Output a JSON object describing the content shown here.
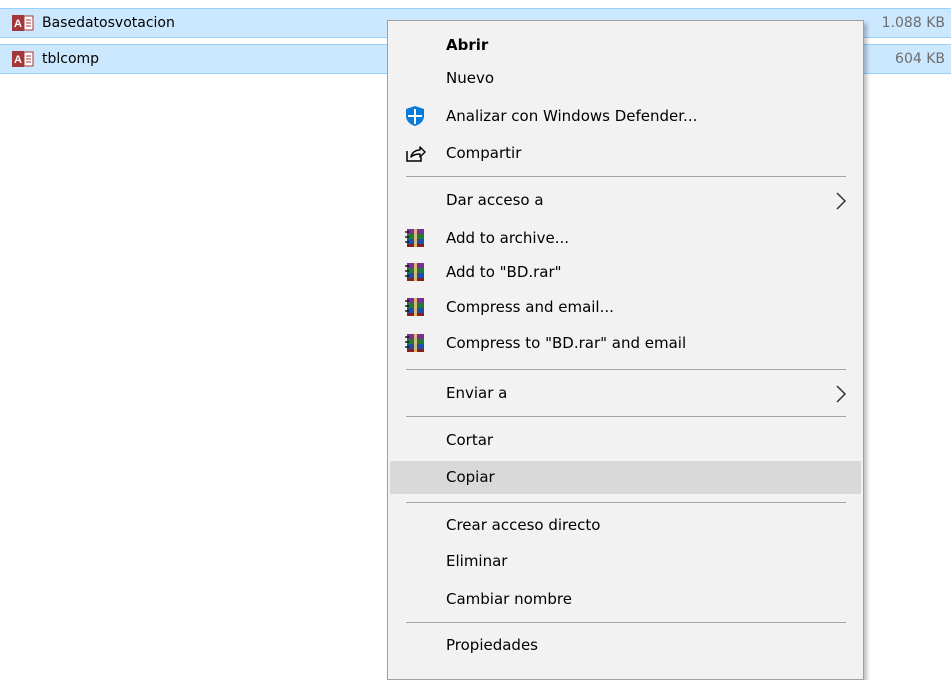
{
  "files": [
    {
      "name": "Basedatosvotacion",
      "size": "1.088 KB",
      "icon": "access-db-icon"
    },
    {
      "name": "tblcomp",
      "size": "604 KB",
      "icon": "access-db-icon"
    }
  ],
  "context_menu": {
    "items": [
      {
        "label": "Abrir",
        "bold": true
      },
      {
        "label": "Nuevo"
      },
      {
        "label": "Analizar con Windows Defender...",
        "icon": "windows-defender-icon"
      },
      {
        "label": "Compartir",
        "icon": "share-icon"
      },
      {
        "label": "Dar acceso a",
        "submenu": true
      },
      {
        "label": "Add to archive...",
        "icon": "winrar-icon"
      },
      {
        "label": "Add to \"BD.rar\"",
        "icon": "winrar-icon"
      },
      {
        "label": "Compress and email...",
        "icon": "winrar-icon"
      },
      {
        "label": "Compress to \"BD.rar\" and email",
        "icon": "winrar-icon"
      },
      {
        "label": "Enviar a",
        "submenu": true
      },
      {
        "label": "Cortar"
      },
      {
        "label": "Copiar",
        "hovered": true
      },
      {
        "label": "Crear acceso directo"
      },
      {
        "label": "Eliminar"
      },
      {
        "label": "Cambiar nombre"
      },
      {
        "label": "Propiedades"
      }
    ]
  },
  "colors": {
    "selection": "#cce8ff",
    "menu_background": "#f2f2f2",
    "menu_hover": "#d9d9d9"
  }
}
